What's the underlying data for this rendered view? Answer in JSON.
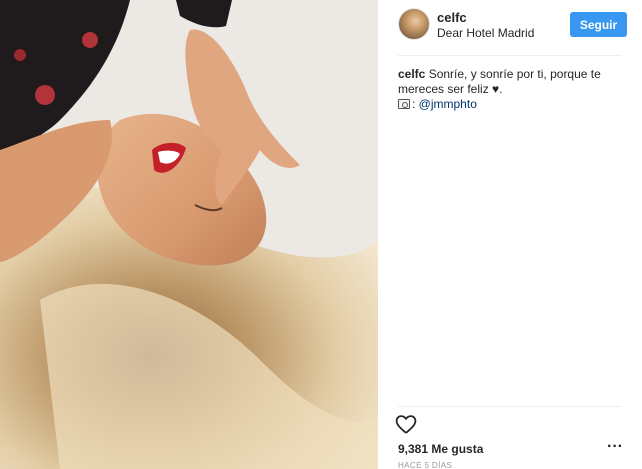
{
  "post": {
    "image_alt": "Smiling woman with blonde hair lying on a bed",
    "header": {
      "username": "celfc",
      "location": "Dear Hotel Madrid",
      "follow_label": "Seguir"
    },
    "caption": {
      "username": "celfc",
      "text": "Sonríe, y sonríe por ti, porque te mereces ser feliz ♥.",
      "credit_prefix": ": ",
      "credit_mention": "@jmmphto"
    },
    "likes_text": "9,381 Me gusta",
    "timestamp": "Hace 5 días",
    "more_label": "···"
  },
  "colors": {
    "accent": "#3897f0",
    "text": "#262626",
    "muted": "#999999",
    "divider": "#efefef"
  },
  "icons": {
    "like": "heart-outline-icon",
    "more": "more-options-icon",
    "credit": "camera-icon"
  }
}
